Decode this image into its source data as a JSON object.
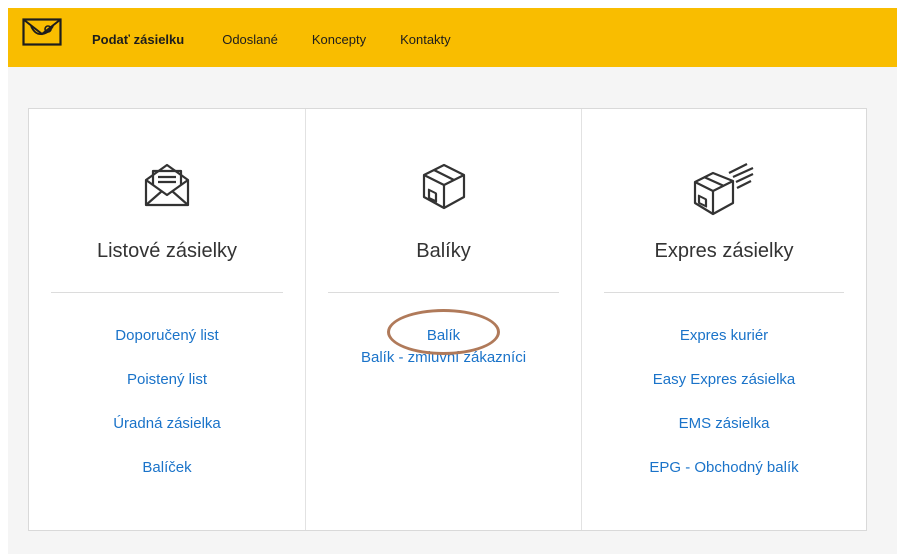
{
  "colors": {
    "topbar": "#f9bd00",
    "link": "#1a73c9",
    "annotation": "#b07a5a"
  },
  "header": {
    "logo_icon": "posthorn-envelope-icon",
    "nav": [
      {
        "label": "Podať zásielku",
        "active": true
      },
      {
        "label": "Odoslané",
        "active": false
      },
      {
        "label": "Koncepty",
        "active": false
      },
      {
        "label": "Kontakty",
        "active": false
      }
    ]
  },
  "columns": [
    {
      "icon": "open-envelope-letter-icon",
      "title": "Listové zásielky",
      "links": [
        "Doporučený list",
        "Poistený list",
        "Úradná zásielka",
        "Balíček"
      ]
    },
    {
      "icon": "package-box-icon",
      "title": "Balíky",
      "links": [
        "Balík",
        "Balík - zmluvní zákazníci"
      ]
    },
    {
      "icon": "express-package-icon",
      "title": "Expres zásielky",
      "links": [
        "Expres kuriér",
        "Easy Expres zásielka",
        "EMS zásielka",
        "EPG - Obchodný balík"
      ]
    }
  ]
}
